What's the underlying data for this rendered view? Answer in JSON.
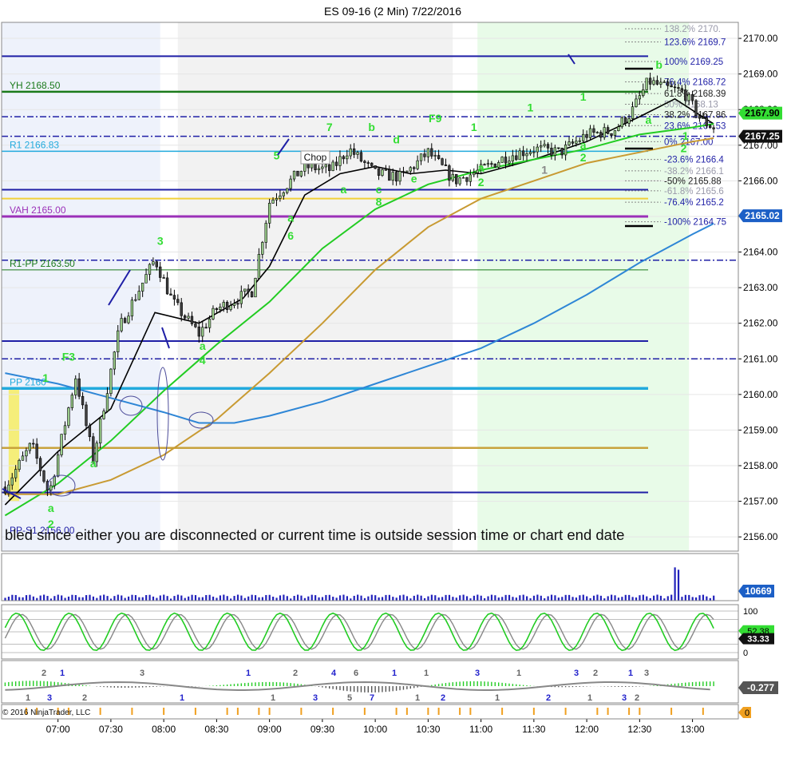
{
  "title": "ES 09-16 (2 Min)  7/22/2016",
  "copyright": "© 2016 NinjaTrader, LLC",
  "status_message": "bled since either you are disconnected or current time is outside session time or chart end date",
  "colors": {
    "candle_up": "#9ccf8c",
    "candle_border": "#000000",
    "ema_fast": "#000000",
    "ema_mid": "#22cc22",
    "ema_slow": "#c89a32",
    "ema_long": "#2e86d6",
    "level_navy": "#1f1fa6",
    "level_green": "#1a7a1a",
    "level_cyan": "#22aadd",
    "level_purple": "#9b30b8",
    "level_gold": "#c8a23c",
    "level_yellow": "#f2d13a",
    "label_green": "#33dd33",
    "session_gray": "#f2f2f2",
    "session_green": "#e8fbe8",
    "session_blue": "#eef2fb"
  },
  "chart_data": {
    "type": "candlestick",
    "title": "ES 09-16 (2 Min)  7/22/2016",
    "y_ticks": [
      "2170.00",
      "2169.00",
      "2168.00",
      "2167.00",
      "2166.00",
      "2165.00",
      "2164.00",
      "2163.00",
      "2162.00",
      "2161.00",
      "2160.00",
      "2159.00",
      "2158.00",
      "2157.00",
      "2156.00"
    ],
    "y_range": [
      2155.6,
      2170.45
    ],
    "x_ticks": [
      "07:00",
      "07:30",
      "08:00",
      "08:30",
      "09:00",
      "09:30",
      "10:00",
      "10:30",
      "11:00",
      "11:30",
      "12:00",
      "12:30",
      "13:00"
    ],
    "time_range": [
      "06:28",
      "13:26"
    ],
    "price_path_time": [
      "06:30",
      "06:45",
      "06:55",
      "07:10",
      "07:20",
      "07:35",
      "07:55",
      "08:05",
      "08:20",
      "08:30",
      "08:50",
      "09:00",
      "09:20",
      "09:35",
      "09:45",
      "10:00",
      "10:15",
      "10:30",
      "10:45",
      "11:00",
      "11:15",
      "11:30",
      "11:45",
      "12:00",
      "12:15",
      "12:25",
      "12:35",
      "12:45",
      "12:55",
      "13:05",
      "13:12"
    ],
    "price_path": [
      2157.4,
      2158.6,
      2157.2,
      2160.5,
      2158.2,
      2161.9,
      2163.8,
      2162.6,
      2161.7,
      2162.4,
      2162.9,
      2165.4,
      2166.4,
      2166.3,
      2166.9,
      2166.2,
      2166.1,
      2166.8,
      2166.0,
      2166.3,
      2166.7,
      2166.9,
      2166.8,
      2167.3,
      2167.4,
      2167.9,
      2168.8,
      2168.6,
      2168.5,
      2167.7,
      2167.5
    ],
    "ema_series": [
      {
        "color_key": "ema_fast",
        "time": [
          "06:30",
          "07:00",
          "07:30",
          "07:55",
          "08:20",
          "08:45",
          "09:00",
          "09:20",
          "09:40",
          "10:00",
          "10:20",
          "10:40",
          "11:00",
          "11:30",
          "12:00",
          "12:30",
          "12:50",
          "13:12"
        ],
        "values": [
          2156.9,
          2158.4,
          2159.6,
          2162.3,
          2162.0,
          2162.7,
          2163.6,
          2165.6,
          2166.2,
          2166.4,
          2166.2,
          2166.3,
          2166.2,
          2166.6,
          2167.1,
          2167.8,
          2168.3,
          2167.6
        ]
      },
      {
        "color_key": "ema_mid",
        "time": [
          "06:30",
          "07:00",
          "07:30",
          "08:00",
          "08:30",
          "09:00",
          "09:30",
          "10:00",
          "10:30",
          "11:00",
          "11:30",
          "12:00",
          "12:30",
          "13:00",
          "13:12"
        ],
        "values": [
          2156.6,
          2157.5,
          2158.7,
          2160.1,
          2161.4,
          2162.6,
          2164.1,
          2165.2,
          2165.9,
          2166.3,
          2166.6,
          2166.9,
          2167.3,
          2167.5,
          2167.6
        ]
      },
      {
        "color_key": "ema_slow",
        "time": [
          "06:30",
          "07:00",
          "07:30",
          "08:00",
          "08:30",
          "09:00",
          "09:30",
          "10:00",
          "10:30",
          "11:00",
          "11:30",
          "12:00",
          "12:30",
          "13:00",
          "13:12"
        ],
        "values": [
          2157.2,
          2157.2,
          2157.6,
          2158.3,
          2159.3,
          2160.6,
          2162.0,
          2163.5,
          2164.7,
          2165.5,
          2166.0,
          2166.5,
          2166.8,
          2167.1,
          2167.2
        ]
      },
      {
        "color_key": "ema_long",
        "time": [
          "06:30",
          "07:00",
          "07:30",
          "08:00",
          "08:20",
          "08:40",
          "09:00",
          "09:30",
          "10:00",
          "10:30",
          "11:00",
          "11:30",
          "12:00",
          "12:30",
          "13:00",
          "13:12"
        ],
        "values": [
          2160.6,
          2160.3,
          2159.9,
          2159.5,
          2159.2,
          2159.2,
          2159.4,
          2159.8,
          2160.3,
          2160.8,
          2161.3,
          2162.0,
          2162.8,
          2163.7,
          2164.5,
          2164.8
        ]
      }
    ],
    "levels": [
      {
        "price": 2169.5,
        "color_key": "level_navy",
        "style": "solid",
        "width": 2
      },
      {
        "price": 2168.5,
        "color_key": "level_green",
        "style": "solid",
        "width": 2.5,
        "label": "YH 2168.50"
      },
      {
        "price": 2167.8,
        "color_key": "level_navy",
        "style": "dashdot",
        "width": 1.5
      },
      {
        "price": 2167.25,
        "color_key": "level_navy",
        "style": "dashdot",
        "width": 1.5
      },
      {
        "price": 2166.83,
        "color_key": "level_cyan",
        "style": "solid",
        "width": 1.5,
        "label": "R1 2166.83"
      },
      {
        "price": 2165.75,
        "color_key": "level_navy",
        "style": "solid",
        "width": 2
      },
      {
        "price": 2165.5,
        "color_key": "level_yellow",
        "style": "solid",
        "width": 2
      },
      {
        "price": 2165.0,
        "color_key": "level_purple",
        "style": "solid",
        "width": 3,
        "label": "VAH 2165.00"
      },
      {
        "price": 2163.77,
        "color_key": "level_navy",
        "style": "dashdot",
        "width": 1.5
      },
      {
        "price": 2163.5,
        "color_key": "level_green",
        "style": "solid",
        "width": 1,
        "label": "R1-PP 2163.50"
      },
      {
        "price": 2161.5,
        "color_key": "level_navy",
        "style": "solid",
        "width": 2
      },
      {
        "price": 2161.0,
        "color_key": "level_navy",
        "style": "dashdot",
        "width": 1.5
      },
      {
        "price": 2160.17,
        "color_key": "level_cyan",
        "style": "solid",
        "width": 3.5,
        "label": "PP 2160"
      },
      {
        "price": 2158.5,
        "color_key": "level_gold",
        "style": "solid",
        "width": 2.5
      },
      {
        "price": 2157.25,
        "color_key": "level_navy",
        "style": "solid",
        "width": 2
      },
      {
        "price": 2156.0,
        "color_key": "level_navy",
        "style": "solid",
        "width": 0,
        "label": "PP-S1 2156.00"
      }
    ],
    "fib_levels": [
      {
        "label": "138.2%  2170.",
        "price": 2170.27,
        "color": "#9999aa"
      },
      {
        "label": "123.6%  2169.7",
        "price": 2169.9,
        "color": "#1f1fa6"
      },
      {
        "label": "100%  2169.25",
        "price": 2169.35,
        "color": "#1f1fa6"
      },
      {
        "label": "76.4%  2168.72",
        "price": 2168.78,
        "color": "#1f1fa6"
      },
      {
        "label": "61.8%  2168.39",
        "price": 2168.45,
        "color": "#222222"
      },
      {
        "label": "50%  2168.13",
        "price": 2168.15,
        "color": "#9999aa"
      },
      {
        "label": "38.2%  2167.86",
        "price": 2167.86,
        "color": "#222222"
      },
      {
        "label": "23.6%  2167.53",
        "price": 2167.55,
        "color": "#1f1fa6"
      },
      {
        "label": "0%  2167.00",
        "price": 2167.1,
        "color": "#1f1fa6"
      },
      {
        "label": "-23.6%  2166.4",
        "price": 2166.6,
        "color": "#1f1fa6"
      },
      {
        "label": "-38.2%  2166.1",
        "price": 2166.28,
        "color": "#9999aa"
      },
      {
        "label": "-50%  2165.88",
        "price": 2166.0,
        "color": "#222222"
      },
      {
        "label": "-61.8%  2165.6",
        "price": 2165.72,
        "color": "#9999aa"
      },
      {
        "label": "-76.4%  2165.2",
        "price": 2165.4,
        "color": "#1f1fa6"
      },
      {
        "label": "-100%  2164.75",
        "price": 2164.85,
        "color": "#1f1fa6"
      }
    ],
    "price_markers": [
      {
        "label": "2167.90",
        "price": 2167.9,
        "style": "green"
      },
      {
        "label": "2167.25",
        "price": 2167.25,
        "style": "black"
      },
      {
        "label": "2165.02",
        "price": 2165.02,
        "style": "blue"
      }
    ],
    "annotations": [
      {
        "text": "F3",
        "time": "07:06",
        "price": 2160.95,
        "color": "#33dd33"
      },
      {
        "text": "1",
        "time": "06:53",
        "price": 2160.35,
        "color": "#33dd33"
      },
      {
        "text": "3",
        "time": "07:58",
        "price": 2164.2,
        "color": "#33dd33"
      },
      {
        "text": "a",
        "time": "08:22",
        "price": 2161.25,
        "color": "#33dd33"
      },
      {
        "text": "4",
        "time": "08:22",
        "price": 2160.85,
        "color": "#33dd33"
      },
      {
        "text": "a",
        "time": "06:56",
        "price": 2156.7,
        "color": "#33dd33"
      },
      {
        "text": "2",
        "time": "06:56",
        "price": 2156.25,
        "color": "#33dd33"
      },
      {
        "text": "a",
        "time": "07:20",
        "price": 2157.95,
        "color": "#33dd33"
      },
      {
        "text": "5",
        "time": "09:04",
        "price": 2166.6,
        "color": "#33dd33"
      },
      {
        "text": "a",
        "time": "09:12",
        "price": 2164.85,
        "color": "#33dd33"
      },
      {
        "text": "6",
        "time": "09:12",
        "price": 2164.35,
        "color": "#33dd33"
      },
      {
        "text": "7",
        "time": "09:34",
        "price": 2167.4,
        "color": "#33dd33"
      },
      {
        "text": "a",
        "time": "09:42",
        "price": 2165.65,
        "color": "#33dd33"
      },
      {
        "text": "b",
        "time": "09:58",
        "price": 2167.4,
        "color": "#33dd33"
      },
      {
        "text": "c",
        "time": "10:02",
        "price": 2165.65,
        "color": "#33dd33"
      },
      {
        "text": "8",
        "time": "10:02",
        "price": 2165.3,
        "color": "#33dd33"
      },
      {
        "text": "d",
        "time": "10:12",
        "price": 2167.05,
        "color": "#33dd33"
      },
      {
        "text": "e",
        "time": "10:22",
        "price": 2165.95,
        "color": "#33dd33"
      },
      {
        "text": "F9",
        "time": "10:34",
        "price": 2167.65,
        "color": "#33dd33"
      },
      {
        "text": "1",
        "time": "10:56",
        "price": 2167.4,
        "color": "#33dd33"
      },
      {
        "text": "a",
        "time": "11:00",
        "price": 2166.25,
        "color": "#33dd33"
      },
      {
        "text": "2",
        "time": "11:00",
        "price": 2165.85,
        "color": "#33dd33"
      },
      {
        "text": "1",
        "time": "11:28",
        "price": 2167.95,
        "color": "#33dd33"
      },
      {
        "text": "1",
        "time": "11:36",
        "price": 2166.2,
        "color": "#888888"
      },
      {
        "text": "1",
        "time": "11:58",
        "price": 2168.25,
        "color": "#33dd33"
      },
      {
        "text": "a",
        "time": "11:58",
        "price": 2166.9,
        "color": "#33dd33"
      },
      {
        "text": "2",
        "time": "11:58",
        "price": 2166.55,
        "color": "#33dd33"
      },
      {
        "text": "b",
        "time": "12:41",
        "price": 2169.15,
        "color": "#33dd33"
      },
      {
        "text": "a",
        "time": "12:35",
        "price": 2167.6,
        "color": "#33dd33"
      },
      {
        "text": "2",
        "time": "12:55",
        "price": 2166.8,
        "color": "#33dd33"
      },
      {
        "text": "1",
        "time": "12:56",
        "price": 2167.15,
        "color": "#33dd33"
      }
    ],
    "chop_label": "Chop",
    "volume": {
      "label": "10669"
    },
    "stochastic": {
      "ticks": [
        "100",
        "0"
      ],
      "labels": [
        "52.38",
        "33.33"
      ]
    },
    "macd": {
      "label": "-0.277",
      "annotations_top": [
        "2",
        "1",
        "3",
        "1",
        "2",
        "4",
        "6",
        "1",
        "1",
        "3",
        "1",
        "3",
        "2",
        "1",
        "3"
      ],
      "annotations_bottom": [
        "1",
        "3",
        "2",
        "1",
        "1",
        "3",
        "5",
        "7",
        "1",
        "2",
        "1",
        "2",
        "1",
        "3",
        "2"
      ]
    }
  }
}
